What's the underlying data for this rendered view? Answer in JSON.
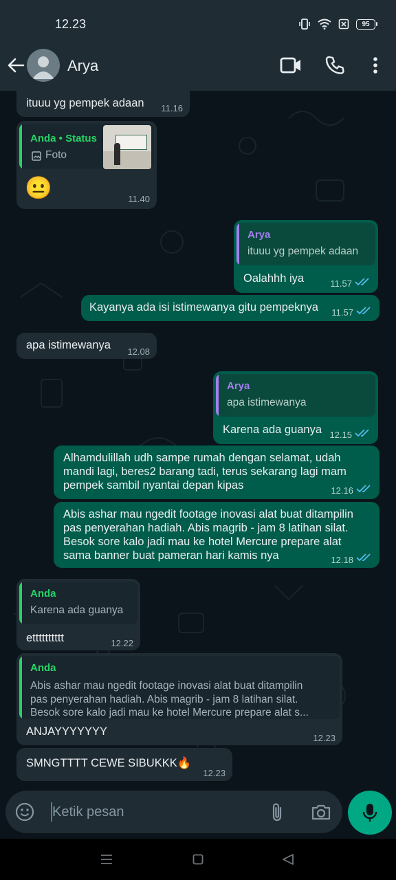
{
  "status": {
    "time": "12.23",
    "battery": "95"
  },
  "header": {
    "contact": "Arya"
  },
  "messages": {
    "m1": {
      "text": "ituuu yg pempek adaan",
      "time": "11.16"
    },
    "m2": {
      "quote_name": "Anda • Status",
      "quote_text": "Foto",
      "text": "😐",
      "time": "11.40"
    },
    "m3": {
      "quote_name": "Arya",
      "quote_text": "ituuu yg pempek adaan",
      "text": "Oalahhh iya",
      "time": "11.57"
    },
    "m4": {
      "text": "Kayanya ada isi istimewanya gitu pempeknya",
      "time": "11.57"
    },
    "m5": {
      "text": "apa istimewanya",
      "time": "12.08"
    },
    "m6": {
      "quote_name": "Arya",
      "quote_text": "apa istimewanya",
      "text": "Karena ada guanya",
      "time": "12.15"
    },
    "m7": {
      "line1": "Alhamdulillah udh sampe rumah dengan selamat, udah",
      "line2": "mandi lagi, beres2 barang tadi, terus sekarang lagi mam",
      "line3": "pempek sambil nyantai depan kipas",
      "time": "12.16"
    },
    "m8": {
      "line1": "Abis ashar mau ngedit footage inovasi alat buat ditampilin",
      "line2": "pas penyerahan hadiah. Abis magrib - jam 8 latihan silat.",
      "line3": "Besok sore kalo jadi mau ke hotel Mercure prepare alat",
      "line4": "sama banner buat pameran hari kamis nya",
      "time": "12.18"
    },
    "m9": {
      "quote_name": "Anda",
      "quote_text": "Karena ada guanya",
      "text": "etttttttttt",
      "time": "12.22"
    },
    "m10": {
      "quote_name": "Anda",
      "q1": "Abis ashar mau ngedit footage inovasi alat buat ditampilin",
      "q2": "pas penyerahan hadiah. Abis magrib - jam 8 latihan silat.",
      "q3": "Besok sore kalo jadi mau ke hotel Mercure prepare alat s...",
      "text": "ANJAYYYYYYY",
      "time": "12.23"
    },
    "m11": {
      "text": "SMNGTTTT CEWE SIBUKKK🔥",
      "time": "12.23"
    }
  },
  "composer": {
    "placeholder": "Ketik pesan"
  },
  "colors": {
    "accent": "#00a884",
    "out_bubble": "#005c4b",
    "in_bubble": "#202c33",
    "quote_you": "#25d366",
    "quote_arya": "#a57ef0",
    "read_ticks": "#53bdeb"
  }
}
